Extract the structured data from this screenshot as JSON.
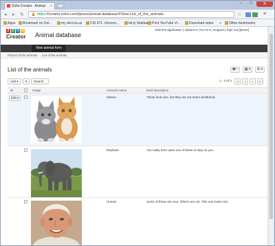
{
  "browser": {
    "tab_title": "Zoho Creator - Animal",
    "tab_close": "×",
    "window_controls": {
      "minimize": "–",
      "maximize": "□",
      "close": "✕"
    },
    "url_scheme": "https",
    "url_rest": "://creator.zoho.com/lpress/animal-database/#View:List_of_the_animals",
    "bookmarks": [
      "Apps",
      "Bookmark on Del...",
      "my del.icio.us",
      "CIS 471: Univers...",
      "bit.ly Sidebar",
      "Print YouTube Vi...",
      "Download video",
      "Other bookmarks"
    ],
    "bookmarks_more": "»"
  },
  "app": {
    "logo_letters": [
      "Z",
      "O",
      "H",
      "O"
    ],
    "logo_colors": [
      "#e2231a",
      "#1a9d49",
      "#1f6fc4",
      "#f4b400"
    ],
    "logo_text": "Creator",
    "title": "Animal database",
    "top_links": "Edit this application  |  Options ▾  |  Go To ▾  |  Support  |  Sign out [lpress]",
    "nav_tab": "New animal form",
    "subnav": [
      "Picture of the animals",
      "List of the animals"
    ]
  },
  "list": {
    "title": "List of the animals",
    "header_buttons": [
      "🖶 ▾",
      "▦ ▾",
      "⚙ ▾"
    ],
    "add_label": "Add ▾",
    "search_label": "Search",
    "pager_text": "1 - 3 of 3",
    "pager_buttons": [
      "|◂",
      "◂",
      "▸",
      "▸|"
    ],
    "columns": [
      "Image",
      "Animal's name",
      "Brief description"
    ],
    "edit_label": "Edit ▾",
    "rows": [
      {
        "name": "Kittens",
        "description": "These look nice, but they are not man's bestfriend."
      },
      {
        "name": "Elephant",
        "description": "You really don't want one of these to step on you."
      },
      {
        "name": "Human",
        "description": "Some of these are nice. Others are not. This one looks nice."
      }
    ]
  }
}
